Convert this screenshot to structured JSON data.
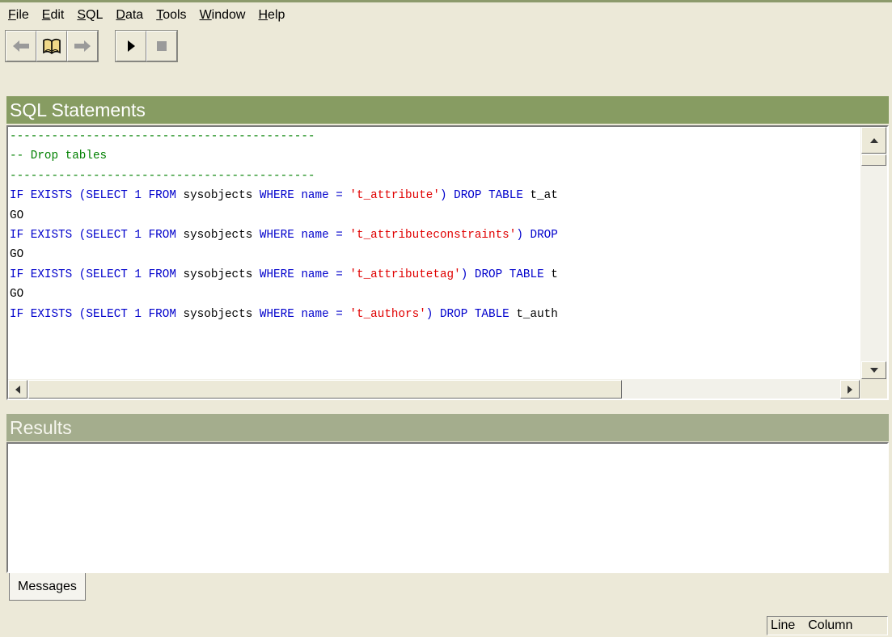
{
  "menu": [
    {
      "pre": "",
      "acc": "F",
      "post": "ile"
    },
    {
      "pre": "",
      "acc": "E",
      "post": "dit"
    },
    {
      "pre": "",
      "acc": "S",
      "post": "QL"
    },
    {
      "pre": "",
      "acc": "D",
      "post": "ata"
    },
    {
      "pre": "",
      "acc": "T",
      "post": "ools"
    },
    {
      "pre": "",
      "acc": "W",
      "post": "indow"
    },
    {
      "pre": "",
      "acc": "H",
      "post": "elp"
    }
  ],
  "toolbar": {
    "icons": [
      "back-arrow-icon",
      "book-icon",
      "forward-arrow-icon",
      "run-icon",
      "stop-icon"
    ]
  },
  "sql_panel": {
    "title": "SQL Statements",
    "lines": [
      [
        {
          "t": "--------------------------------------------",
          "c": "comment"
        }
      ],
      [
        {
          "t": "-- Drop tables",
          "c": "comment"
        }
      ],
      [
        {
          "t": "--------------------------------------------",
          "c": "comment"
        }
      ],
      [
        {
          "t": "IF EXISTS (SELECT 1 FROM ",
          "c": "kw"
        },
        {
          "t": "sysobjects ",
          "c": "plain"
        },
        {
          "t": "WHERE name = ",
          "c": "kw"
        },
        {
          "t": "'t_attribute'",
          "c": "str"
        },
        {
          "t": ") DROP TABLE ",
          "c": "kw"
        },
        {
          "t": "t_at",
          "c": "plain"
        }
      ],
      [
        {
          "t": "GO",
          "c": "plain"
        }
      ],
      [
        {
          "t": "IF EXISTS (SELECT 1 FROM ",
          "c": "kw"
        },
        {
          "t": "sysobjects ",
          "c": "plain"
        },
        {
          "t": "WHERE name = ",
          "c": "kw"
        },
        {
          "t": "'t_attributeconstraints'",
          "c": "str"
        },
        {
          "t": ") DROP",
          "c": "kw"
        }
      ],
      [
        {
          "t": "GO",
          "c": "plain"
        }
      ],
      [
        {
          "t": "IF EXISTS (SELECT 1 FROM ",
          "c": "kw"
        },
        {
          "t": "sysobjects ",
          "c": "plain"
        },
        {
          "t": "WHERE name = ",
          "c": "kw"
        },
        {
          "t": "'t_attributetag'",
          "c": "str"
        },
        {
          "t": ") DROP TABLE ",
          "c": "kw"
        },
        {
          "t": "t",
          "c": "plain"
        }
      ],
      [
        {
          "t": "GO",
          "c": "plain"
        }
      ],
      [
        {
          "t": "IF EXISTS (SELECT 1 FROM ",
          "c": "kw"
        },
        {
          "t": "sysobjects ",
          "c": "plain"
        },
        {
          "t": "WHERE name = ",
          "c": "kw"
        },
        {
          "t": "'t_authors'",
          "c": "str"
        },
        {
          "t": ") DROP TABLE ",
          "c": "kw"
        },
        {
          "t": "t_auth",
          "c": "plain"
        }
      ]
    ]
  },
  "results_panel": {
    "title": "Results",
    "tab_label": "Messages"
  },
  "status": {
    "line_label": "Line",
    "column_label": "Column"
  },
  "colors": {
    "header_active": "#879c62",
    "header_inactive": "#a4ad8d",
    "keyword": "#0000cc",
    "string": "#e00000",
    "comment": "#008000"
  }
}
